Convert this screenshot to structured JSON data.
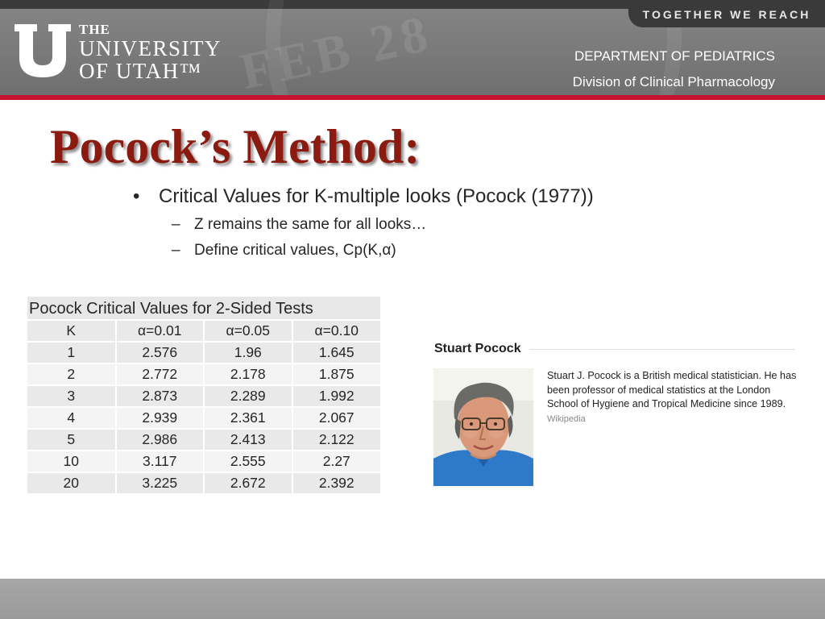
{
  "header": {
    "tagline": "TOGETHER WE REACH",
    "logo": {
      "the": "THE",
      "university": "UNIVERSITY",
      "of_utah": "OF UTAH™"
    },
    "department": "DEPARTMENT OF PEDIATRICS",
    "division": "Division of Clinical Pharmacology",
    "seal_text": "FEB 28"
  },
  "slide": {
    "title": "Pocock’s Method:",
    "bullet": "Critical Values for K-multiple looks (Pocock (1977))",
    "subbullets": [
      "Z  remains the same for all looks…",
      "Define critical values, Cp(K,α)"
    ]
  },
  "table": {
    "caption": "Pocock Critical Values for 2-Sided Tests",
    "columns": [
      "K",
      "α=0.01",
      "α=0.05",
      "α=0.10"
    ],
    "rows": [
      [
        "1",
        "2.576",
        "1.96",
        "1.645"
      ],
      [
        "2",
        "2.772",
        "2.178",
        "1.875"
      ],
      [
        "3",
        "2.873",
        "2.289",
        "1.992"
      ],
      [
        "4",
        "2.939",
        "2.361",
        "2.067"
      ],
      [
        "5",
        "2.986",
        "2.413",
        "2.122"
      ],
      [
        "10",
        "3.117",
        "2.555",
        "2.27"
      ],
      [
        "20",
        "3.225",
        "2.672",
        "2.392"
      ]
    ]
  },
  "card": {
    "name": "Stuart Pocock",
    "bio": "Stuart J. Pocock is a British medical statistician. He has been professor of medical statistics at the London School of Hygiene and Tropical Medicine since 1989.",
    "source": "Wikipedia"
  },
  "colors": {
    "title": "#8b1a10",
    "accent_red": "#c41230",
    "header_gray": "#7a7a7a",
    "table_cell": "#e9e9e9"
  }
}
